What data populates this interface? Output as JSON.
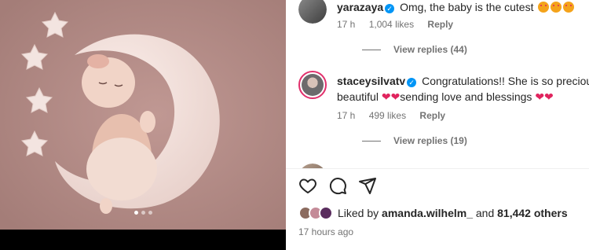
{
  "carousel": {
    "slide_count": 3,
    "active_slide": 1
  },
  "comments": [
    {
      "username": "yarazaya",
      "verified": true,
      "text": "Omg, the baby is the cutest",
      "emojis": [
        "heart-eyes-emoji",
        "heart-eyes-emoji",
        "heart-eyes-emoji"
      ],
      "time": "17 h",
      "likes": "1,004 likes",
      "reply_label": "Reply",
      "view_replies": "View replies (44)"
    },
    {
      "username": "staceysilvatv",
      "verified": true,
      "text_part1": "Congratulations!! She is so precious a",
      "text_part2": "beautiful",
      "text_part3": "sending love and blessings",
      "time": "17 h",
      "likes": "499 likes",
      "reply_label": "Reply",
      "view_replies": "View replies (19)"
    }
  ],
  "actions": [
    "heart-icon",
    "comment-icon",
    "share-icon"
  ],
  "likes": {
    "prefix": "Liked by",
    "user": "amanda.wilhelm_",
    "and": "and",
    "others": "81,442 others"
  },
  "timestamp": "17 hours ago",
  "colors": {
    "accent": "#0095f6",
    "heart": "#e0245e",
    "muted": "#737373",
    "photo_bg": "#b18a84"
  }
}
